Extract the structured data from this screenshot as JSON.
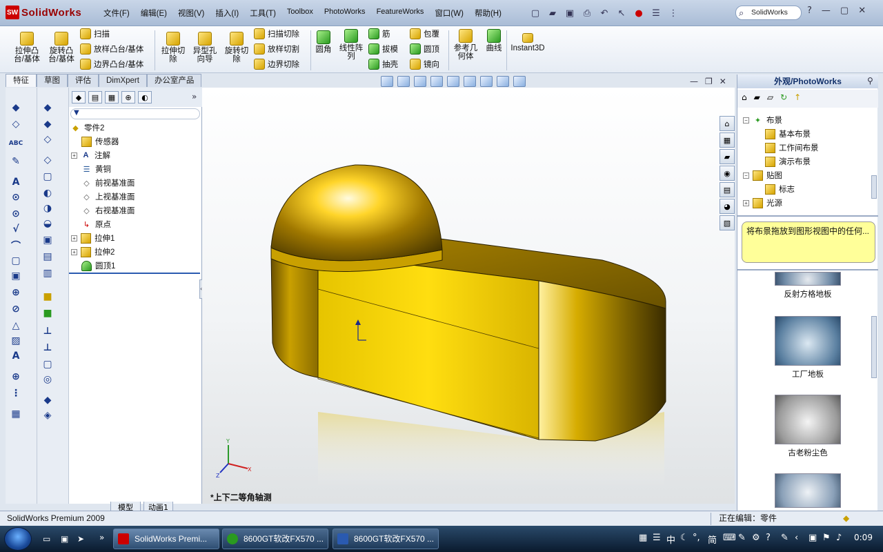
{
  "app": {
    "logo_text": "SolidWorks",
    "logo_badge": "SW"
  },
  "menu": [
    "文件(F)",
    "编辑(E)",
    "视图(V)",
    "插入(I)",
    "工具(T)",
    "Toolbox",
    "PhotoWorks",
    "FeatureWorks",
    "窗口(W)",
    "帮助(H)"
  ],
  "search": {
    "value": "SolidWorks"
  },
  "commands": {
    "extrude_boss": "拉伸凸台/基体",
    "revolve_boss": "旋转凸台/基体",
    "sweep": "扫描",
    "loft": "放样凸台/基体",
    "boundary": "边界凸台/基体",
    "extrude_cut": "拉伸切除",
    "hole_wizard": "异型孔向导",
    "revolve_cut": "旋转切除",
    "swept_cut": "扫描切除",
    "lofted_cut": "放样切割",
    "boundary_cut": "边界切除",
    "fillet": "圆角",
    "linear_pattern": "线性阵列",
    "rib": "筋",
    "draft": "拔模",
    "shell": "抽壳",
    "wrap": "包覆",
    "dome": "圆顶",
    "mirror": "镜向",
    "ref_geometry": "参考几何体",
    "curves": "曲线",
    "instant3d": "Instant3D"
  },
  "tabs": [
    "特征",
    "草图",
    "评估",
    "DimXpert",
    "办公室产品"
  ],
  "feature_tree": {
    "root": "零件2",
    "items": [
      {
        "label": "传感器",
        "expandable": false
      },
      {
        "label": "注解",
        "expandable": true
      },
      {
        "label": "黄铜",
        "expandable": false
      },
      {
        "label": "前视基准面",
        "expandable": false
      },
      {
        "label": "上视基准面",
        "expandable": false
      },
      {
        "label": "右视基准面",
        "expandable": false
      },
      {
        "label": "原点",
        "expandable": false
      },
      {
        "label": "拉伸1",
        "expandable": true
      },
      {
        "label": "拉伸2",
        "expandable": true
      },
      {
        "label": "圆顶1",
        "expandable": false
      }
    ],
    "bottom_tabs": [
      "模型",
      "动画1"
    ]
  },
  "graphics": {
    "view_name": "*上下二等角轴测"
  },
  "task_pane": {
    "title": "外观/PhotoWorks",
    "tree": [
      {
        "label": "布景",
        "level": 0
      },
      {
        "label": "基本布景",
        "level": 1
      },
      {
        "label": "工作间布景",
        "level": 1
      },
      {
        "label": "演示布景",
        "level": 1
      },
      {
        "label": "贴图",
        "level": 0
      },
      {
        "label": "标志",
        "level": 1
      },
      {
        "label": "光源",
        "level": 0
      }
    ],
    "tooltip": "将布景拖放到图形视图中的任何...",
    "library": [
      "反射方格地板",
      "工厂地板",
      "古老粉尘色"
    ]
  },
  "status": {
    "left": "SolidWorks Premium 2009",
    "right": "正在编辑：零件"
  },
  "taskbar": {
    "tasks": [
      "SolidWorks Premi...",
      "8600GT软改FX570 ...",
      "8600GT软改FX570 ..."
    ],
    "clock": "0:09",
    "ime": "简"
  },
  "colors": {
    "brass": "#c9a000",
    "accent_blue": "#12306a",
    "tooltip_bg": "#ffff99"
  }
}
